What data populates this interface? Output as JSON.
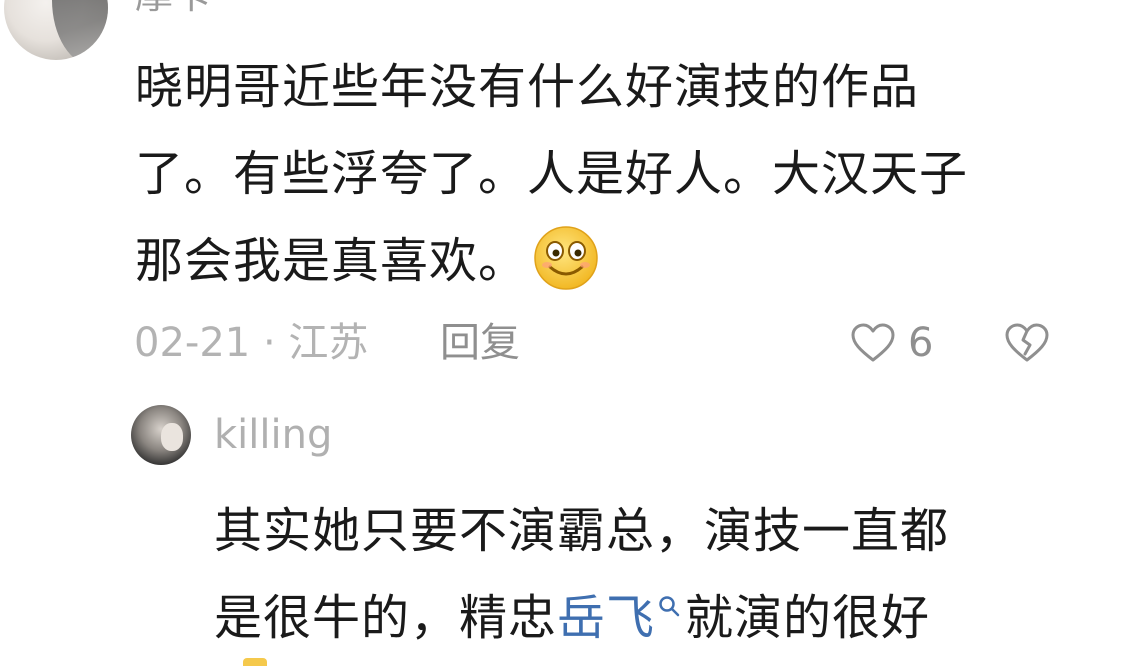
{
  "main_comment": {
    "username": "摩卡",
    "lines": [
      "晓明哥近些年没有什么好演技的作品",
      "了。有些浮夸了。人是好人。大汉天子",
      "那会我是真喜欢。"
    ],
    "emoji": "smile-emoji",
    "date_location": "02-21 · 江苏",
    "reply_label": "回复",
    "like_count": "6"
  },
  "reply": {
    "username": "killing",
    "line1": "其实她只要不演霸总，演技一直都",
    "line2_before": "是很牛的，精忠",
    "line2_link": "岳飞",
    "line2_after": "就演的很好"
  },
  "colors": {
    "text": "#1a1a1a",
    "meta": "#b3b3b3",
    "link": "#3f6fb0"
  }
}
